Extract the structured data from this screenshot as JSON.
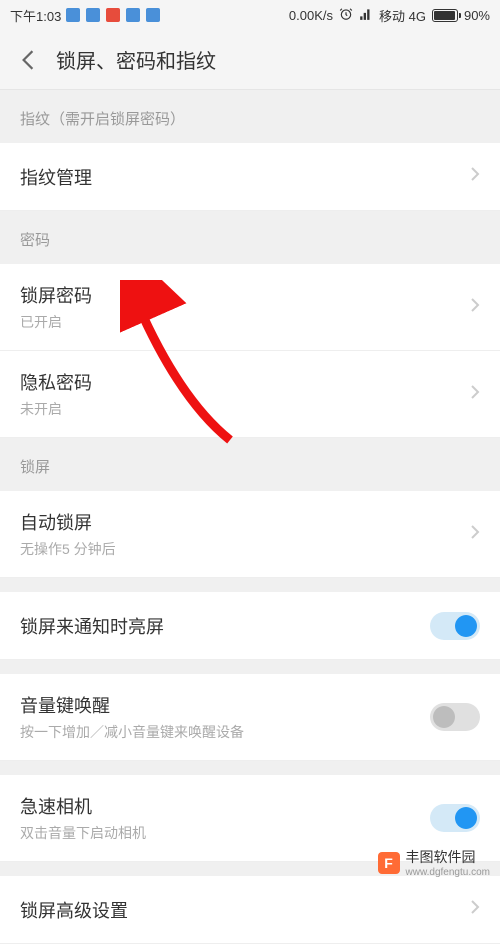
{
  "statusBar": {
    "time": "下午1:03",
    "speed": "0.00K/s",
    "network": "移动 4G",
    "battery": "90%"
  },
  "header": {
    "title": "锁屏、密码和指纹"
  },
  "sections": {
    "fingerprint": {
      "header": "指纹（需开启锁屏密码）",
      "items": [
        {
          "title": "指纹管理",
          "type": "nav"
        }
      ]
    },
    "password": {
      "header": "密码",
      "items": [
        {
          "title": "锁屏密码",
          "sub": "已开启",
          "type": "nav"
        },
        {
          "title": "隐私密码",
          "sub": "未开启",
          "type": "nav"
        }
      ]
    },
    "lockscreen": {
      "header": "锁屏",
      "items": [
        {
          "title": "自动锁屏",
          "sub": "无操作5 分钟后",
          "type": "nav"
        },
        {
          "title": "锁屏来通知时亮屏",
          "type": "toggle",
          "value": true
        },
        {
          "title": "音量键唤醒",
          "sub": "按一下增加／减小音量键来唤醒设备",
          "type": "toggle",
          "value": false
        },
        {
          "title": "急速相机",
          "sub": "双击音量下启动相机",
          "type": "toggle",
          "value": true
        },
        {
          "title": "锁屏高级设置",
          "type": "nav"
        }
      ]
    }
  },
  "watermark": {
    "logo": "F",
    "text": "丰图软件园",
    "url": "www.dgfengtu.com"
  }
}
